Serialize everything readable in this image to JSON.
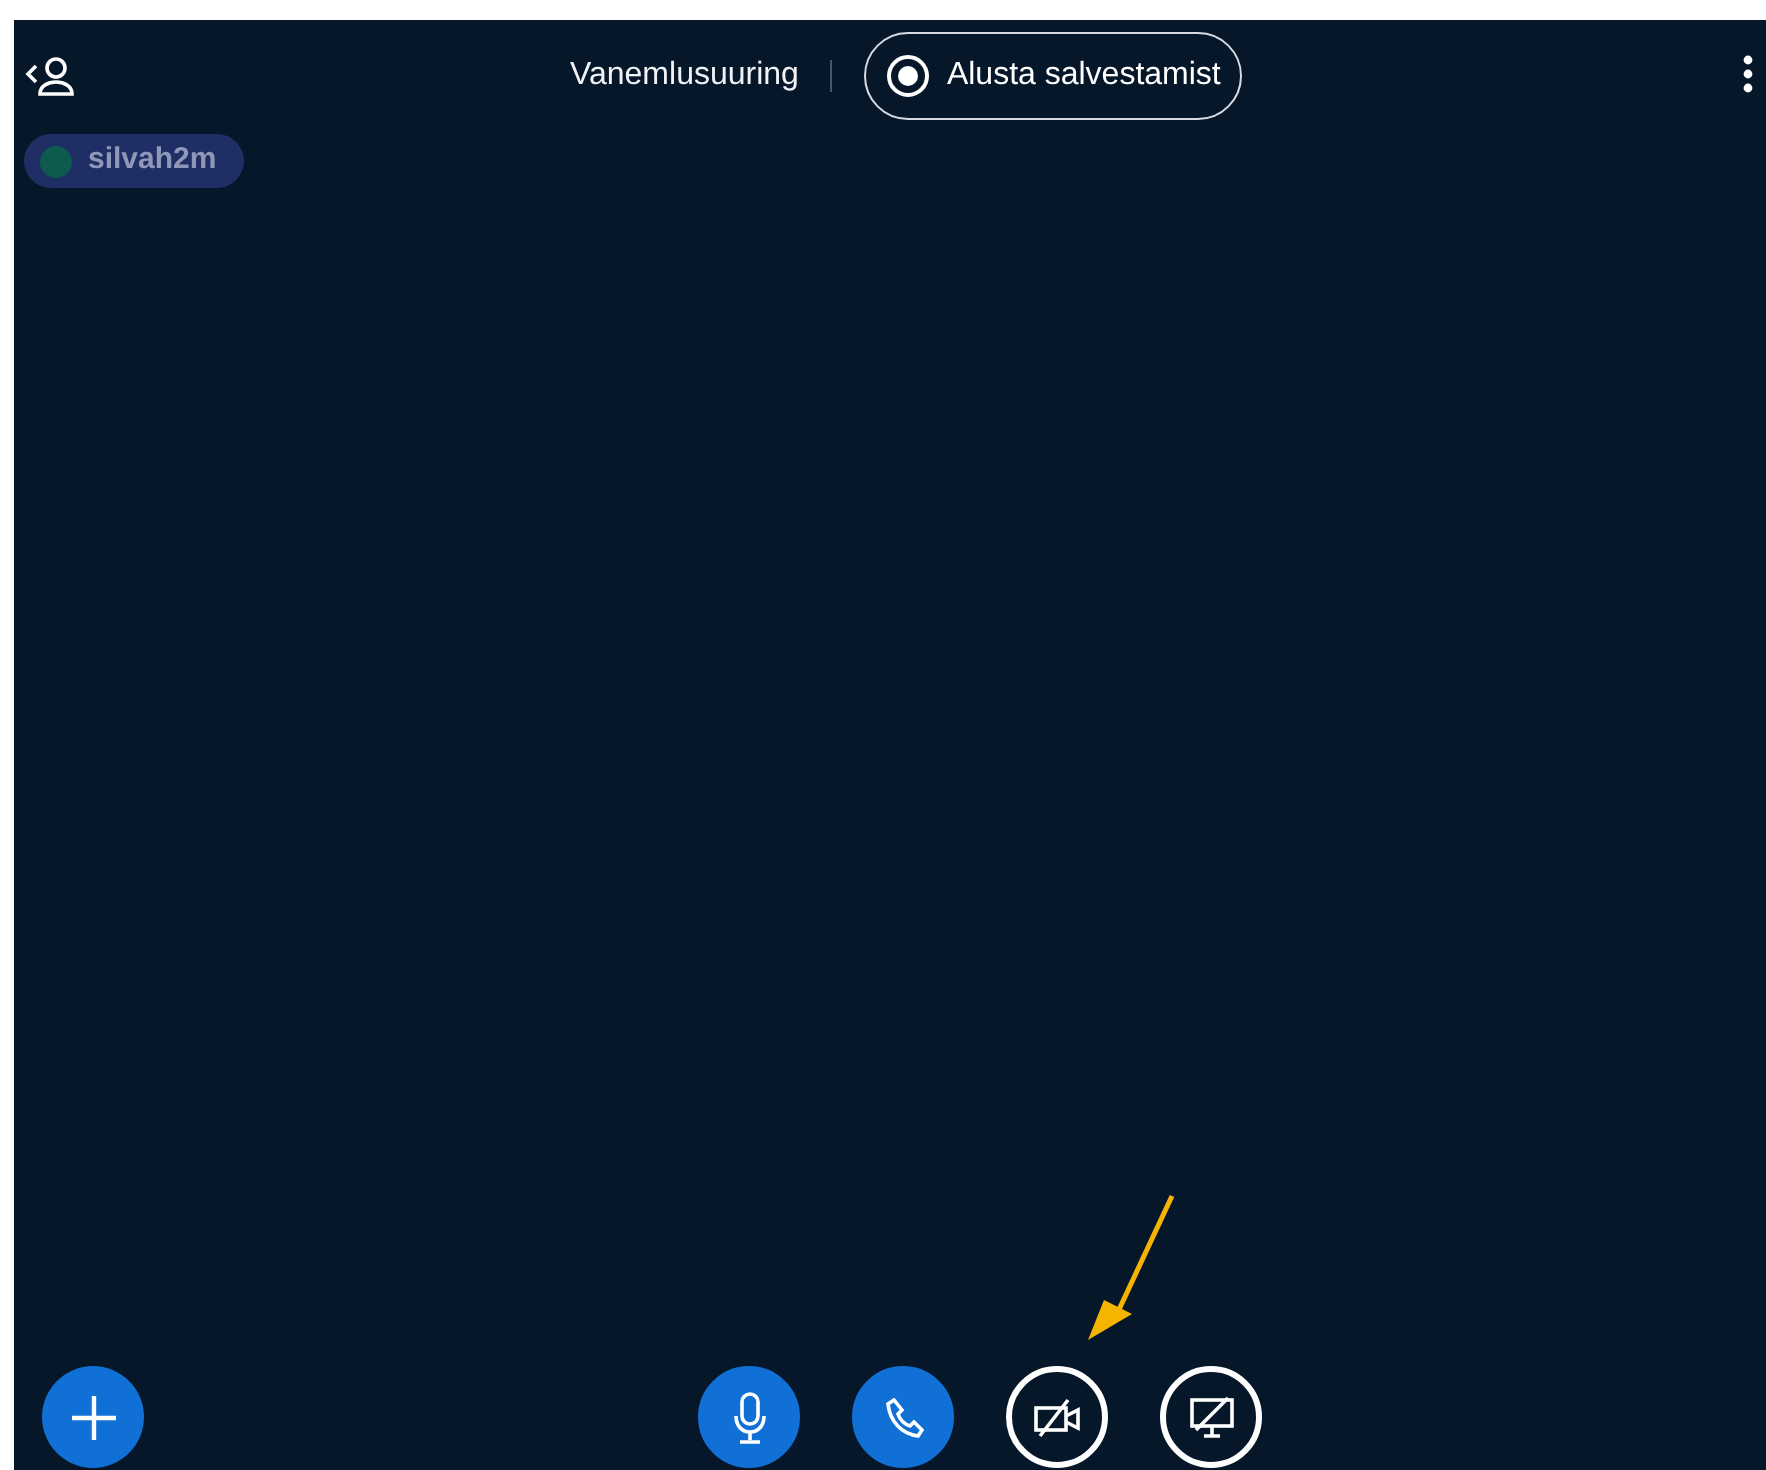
{
  "meeting_title": "Vanemlusuuring",
  "record_button": {
    "label": "Alusta salvestamist",
    "recording": false
  },
  "users": [
    {
      "name": "silvah2m",
      "color": "#0d5a4f"
    }
  ],
  "controls": [
    {
      "kind": "microphone",
      "on": true
    },
    {
      "kind": "phone",
      "on": true
    },
    {
      "kind": "camera",
      "on": false
    },
    {
      "kind": "screen_share",
      "on": false
    }
  ]
}
